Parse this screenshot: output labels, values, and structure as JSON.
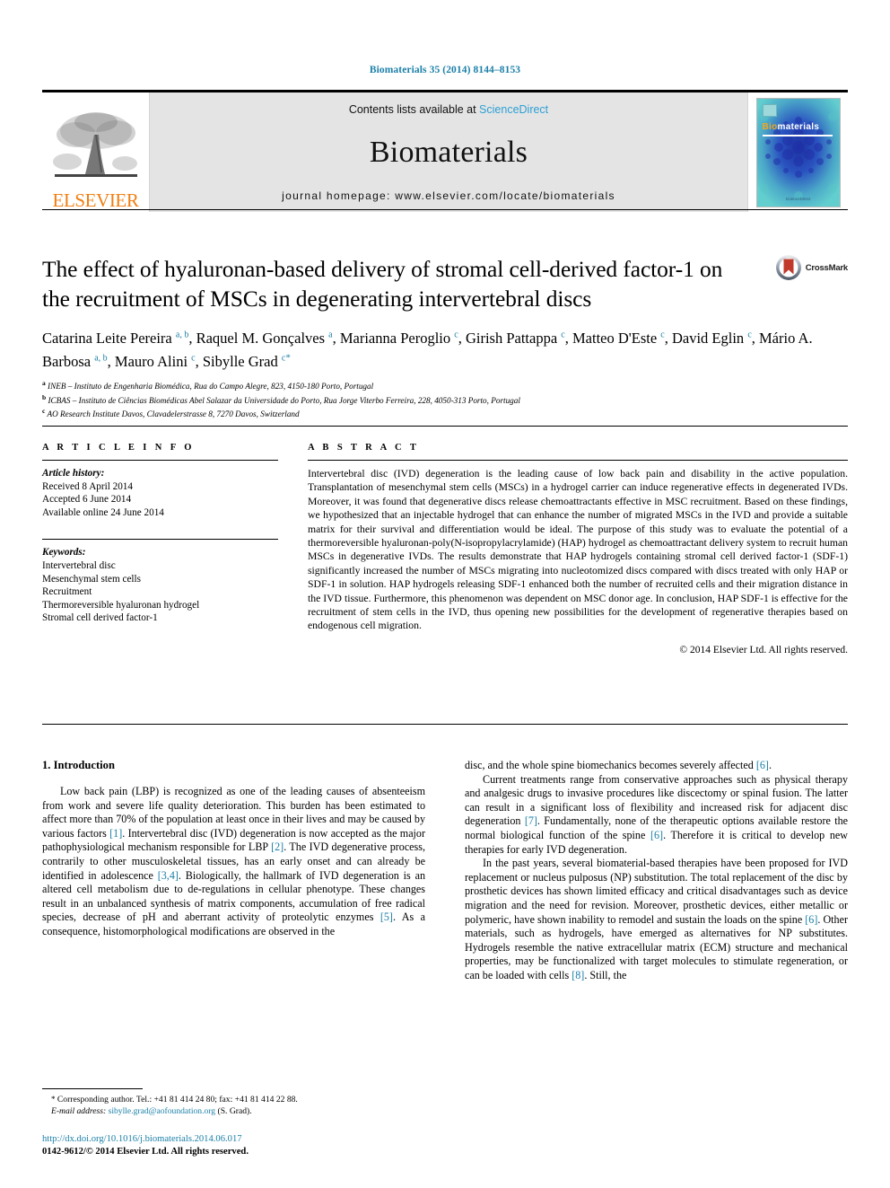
{
  "running_head": "Biomaterials 35 (2014) 8144–8153",
  "masthead": {
    "publisher_name": "ELSEVIER",
    "publisher_logo_icon": "elsevier-tree-icon",
    "contents_prefix": "Contents lists available at ",
    "contents_link": "ScienceDirect",
    "journal_name": "Biomaterials",
    "homepage_line": "journal homepage: www.elsevier.com/locate/biomaterials",
    "cover": {
      "title_first": "Bio",
      "title_rest": "materials",
      "footer_text": "ScienceDirect"
    }
  },
  "article": {
    "title": "The effect of hyaluronan-based delivery of stromal cell-derived factor-1 on the recruitment of MSCs in degenerating intervertebral discs",
    "crossmark_label": "CrossMark",
    "crossmark_icon": "crossmark-icon",
    "authors": [
      {
        "name": "Catarina Leite Pereira",
        "marks": "a, b",
        "sep": ", "
      },
      {
        "name": "Raquel M. Gonçalves",
        "marks": "a",
        "sep": ", "
      },
      {
        "name": "Marianna Peroglio",
        "marks": "c",
        "sep": ", "
      },
      {
        "name": "Girish Pattappa",
        "marks": "c",
        "sep": ", "
      },
      {
        "name": "Matteo D'Este",
        "marks": "c",
        "sep": ", "
      },
      {
        "name": "David Eglin",
        "marks": "c",
        "sep": ", "
      },
      {
        "name": "Mário A. Barbosa",
        "marks": "a, b",
        "sep": ", "
      },
      {
        "name": "Mauro Alini",
        "marks": "c",
        "sep": ", "
      },
      {
        "name": "Sibylle Grad",
        "marks": "c",
        "sep": "",
        "corresponding": "*"
      }
    ],
    "affiliations": [
      {
        "mark": "a",
        "text": "INEB – Instituto de Engenharia Biomédica, Rua do Campo Alegre, 823, 4150-180 Porto, Portugal"
      },
      {
        "mark": "b",
        "text": "ICBAS – Instituto de Ciências Biomédicas Abel Salazar da Universidade do Porto, Rua Jorge Viterbo Ferreira, 228, 4050-313 Porto, Portugal"
      },
      {
        "mark": "c",
        "text": "AO Research Institute Davos, Clavadelerstrasse 8, 7270 Davos, Switzerland"
      }
    ]
  },
  "article_info": {
    "heading": "A R T I C L E   I N F O",
    "history_label": "Article history:",
    "history": [
      "Received 8 April 2014",
      "Accepted 6 June 2014",
      "Available online 24 June 2014"
    ],
    "keywords_label": "Keywords:",
    "keywords": [
      "Intervertebral disc",
      "Mesenchymal stem cells",
      "Recruitment",
      "Thermoreversible hyaluronan hydrogel",
      "Stromal cell derived factor-1"
    ]
  },
  "abstract": {
    "heading": "A B S T R A C T",
    "text": "Intervertebral disc (IVD) degeneration is the leading cause of low back pain and disability in the active population. Transplantation of mesenchymal stem cells (MSCs) in a hydrogel carrier can induce regenerative effects in degenerated IVDs. Moreover, it was found that degenerative discs release chemoattractants effective in MSC recruitment. Based on these findings, we hypothesized that an injectable hydrogel that can enhance the number of migrated MSCs in the IVD and provide a suitable matrix for their survival and differentiation would be ideal. The purpose of this study was to evaluate the potential of a thermoreversible hyaluronan-poly(N-isopropylacrylamide) (HAP) hydrogel as chemoattractant delivery system to recruit human MSCs in degenerative IVDs. The results demonstrate that HAP hydrogels containing stromal cell derived factor-1 (SDF-1) significantly increased the number of MSCs migrating into nucleotomized discs compared with discs treated with only HAP or SDF-1 in solution. HAP hydrogels releasing SDF-1 enhanced both the number of recruited cells and their migration distance in the IVD tissue. Furthermore, this phenomenon was dependent on MSC donor age. In conclusion, HAP SDF-1 is effective for the recruitment of stem cells in the IVD, thus opening new possibilities for the development of regenerative therapies based on endogenous cell migration.",
    "copyright": "© 2014 Elsevier Ltd. All rights reserved."
  },
  "body": {
    "section_title": "1. Introduction",
    "left_paragraphs": [
      {
        "parts": [
          {
            "t": "Low back pain (LBP) is recognized as one of the leading causes of absenteeism from work and severe life quality deterioration. This burden has been estimated to affect more than 70% of the population at least once in their lives and may be caused by various factors "
          },
          {
            "t": "[1]",
            "ref": true
          },
          {
            "t": ". Intervertebral disc (IVD) degeneration is now accepted as the major pathophysiological mechanism responsible for LBP "
          },
          {
            "t": "[2]",
            "ref": true
          },
          {
            "t": ". The IVD degenerative process, contrarily to other musculoskeletal tissues, has an early onset and can already be identified in adolescence "
          },
          {
            "t": "[3,4]",
            "ref": true
          },
          {
            "t": ". Biologically, the hallmark of IVD degeneration is an altered cell metabolism due to de-regulations in cellular phenotype. These changes result in an unbalanced synthesis of matrix components, accumulation of free radical species, decrease of pH and aberrant activity of proteolytic enzymes "
          },
          {
            "t": "[5]",
            "ref": true
          },
          {
            "t": ". As a consequence, histomorphological modifications are observed in the"
          }
        ]
      }
    ],
    "right_paragraphs": [
      {
        "indent": false,
        "parts": [
          {
            "t": "disc, and the whole spine biomechanics becomes severely affected "
          },
          {
            "t": "[6]",
            "ref": true
          },
          {
            "t": "."
          }
        ]
      },
      {
        "indent": true,
        "parts": [
          {
            "t": "Current treatments range from conservative approaches such as physical therapy and analgesic drugs to invasive procedures like discectomy or spinal fusion. The latter can result in a significant loss of flexibility and increased risk for adjacent disc degeneration "
          },
          {
            "t": "[7]",
            "ref": true
          },
          {
            "t": ". Fundamentally, none of the therapeutic options available restore the normal biological function of the spine "
          },
          {
            "t": "[6]",
            "ref": true
          },
          {
            "t": ". Therefore it is critical to develop new therapies for early IVD degeneration."
          }
        ]
      },
      {
        "indent": true,
        "parts": [
          {
            "t": "In the past years, several biomaterial-based therapies have been proposed for IVD replacement or nucleus pulposus (NP) substitution. The total replacement of the disc by prosthetic devices has shown limited efficacy and critical disadvantages such as device migration and the need for revision. Moreover, prosthetic devices, either metallic or polymeric, have shown inability to remodel and sustain the loads on the spine "
          },
          {
            "t": "[6]",
            "ref": true
          },
          {
            "t": ". Other materials, such as hydrogels, have emerged as alternatives for NP substitutes. Hydrogels resemble the native extracellular matrix (ECM) structure and mechanical properties, may be functionalized with target molecules to stimulate regeneration, or can be loaded with cells "
          },
          {
            "t": "[8]",
            "ref": true
          },
          {
            "t": ". Still, the"
          }
        ]
      }
    ]
  },
  "footnote": {
    "corresponding_line": "Corresponding author. Tel.: +41 81 414 24 80; fax: +41 81 414 22 88.",
    "email_label": "E-mail address:",
    "email": "sibylle.grad@aofoundation.org",
    "email_suffix": " (S. Grad)."
  },
  "footer": {
    "doi": "http://dx.doi.org/10.1016/j.biomaterials.2014.06.017",
    "issn_line": "0142-9612/© 2014 Elsevier Ltd. All rights reserved."
  },
  "colors": {
    "link_blue": "#1a7fa8",
    "sciencedirect_blue": "#2e9fd4",
    "elsevier_orange": "#F07F13",
    "cover_teal": "#3fbfc4",
    "crossmark_red": "#c0392b"
  }
}
